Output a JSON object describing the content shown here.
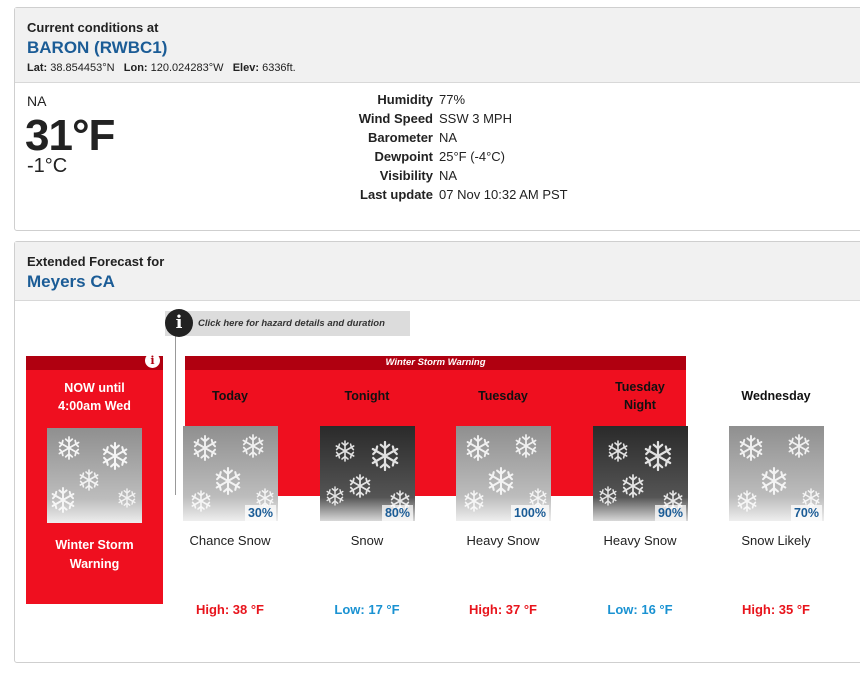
{
  "current": {
    "heading": "Current conditions at",
    "station": "BARON (RWBC1)",
    "lat_label": "Lat:",
    "lat": "38.854453°N",
    "lon_label": "Lon:",
    "lon": "120.024283°W",
    "elev_label": "Elev:",
    "elev": "6336ft.",
    "condition": "NA",
    "temp_f": "31°F",
    "temp_c": "-1°C",
    "details": [
      {
        "label": "Humidity",
        "value": "77%"
      },
      {
        "label": "Wind Speed",
        "value": "SSW 3 MPH"
      },
      {
        "label": "Barometer",
        "value": "NA"
      },
      {
        "label": "Dewpoint",
        "value": "25°F (-4°C)"
      },
      {
        "label": "Visibility",
        "value": "NA"
      },
      {
        "label": "Last update",
        "value": "07 Nov 10:32 AM PST"
      }
    ]
  },
  "forecast": {
    "heading": "Extended Forecast for",
    "location": "Meyers CA",
    "hazard_link": "Click here for hazard details and duration",
    "warning_banner": "Winter Storm Warning",
    "now": {
      "title_line1": "NOW until",
      "title_line2": "4:00am Wed",
      "desc_line1": "Winter Storm",
      "desc_line2": "Warning",
      "icon": "snow-icon"
    },
    "days": [
      {
        "name_line1": "Today",
        "name_line2": "",
        "pop": "30%",
        "desc": "Chance Snow",
        "temp": "High: 38 °F",
        "kind": "hi",
        "night": false
      },
      {
        "name_line1": "Tonight",
        "name_line2": "",
        "pop": "80%",
        "desc": "Snow",
        "temp": "Low: 17 °F",
        "kind": "lo",
        "night": true
      },
      {
        "name_line1": "Tuesday",
        "name_line2": "",
        "pop": "100%",
        "desc": "Heavy Snow",
        "temp": "High: 37 °F",
        "kind": "hi",
        "night": false
      },
      {
        "name_line1": "Tuesday",
        "name_line2": "Night",
        "pop": "90%",
        "desc": "Heavy Snow",
        "temp": "Low: 16 °F",
        "kind": "lo",
        "night": true
      },
      {
        "name_line1": "Wednesday",
        "name_line2": "",
        "pop": "70%",
        "desc": "Snow Likely",
        "temp": "High: 35 °F",
        "kind": "hi",
        "night": false
      }
    ]
  },
  "colors": {
    "link_blue": "#1b5c96",
    "warning_red": "#ef0f1f",
    "warning_dark": "#b00010",
    "high_red": "#e8141c",
    "low_blue": "#1a92d2"
  }
}
